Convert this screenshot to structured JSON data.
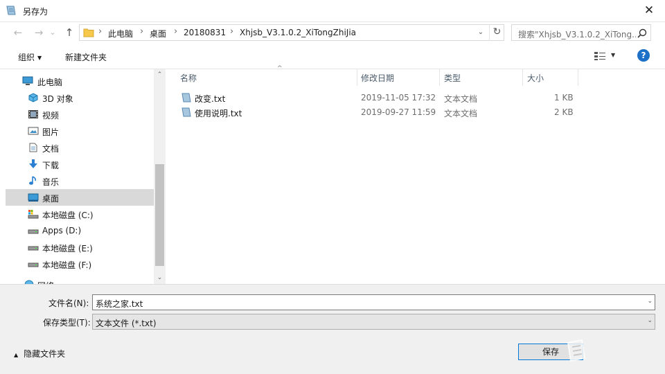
{
  "window": {
    "title": "另存为",
    "close_glyph": "✕"
  },
  "nav": {
    "back_glyph": "←",
    "forward_glyph": "→",
    "recent_glyph": "⌄",
    "up_glyph": "↑",
    "breadcrumb": [
      "此电脑",
      "桌面",
      "20180831",
      "Xhjsb_V3.1.0.2_XiTongZhiJia"
    ],
    "separator": "›",
    "dropdown_glyph": "⌄",
    "refresh_glyph": "↻",
    "search_placeholder": "搜索\"Xhjsb_V3.1.0.2_XiTong..."
  },
  "toolbar": {
    "organize": "组织",
    "caret": "▼",
    "new_folder": "新建文件夹",
    "help": "?"
  },
  "sidebar": {
    "items": [
      {
        "label": "此电脑",
        "icon": "pc-icon"
      },
      {
        "label": "3D 对象",
        "icon": "3d-objects-icon"
      },
      {
        "label": "视频",
        "icon": "video-icon"
      },
      {
        "label": "图片",
        "icon": "pictures-icon"
      },
      {
        "label": "文档",
        "icon": "documents-icon"
      },
      {
        "label": "下载",
        "icon": "download-icon"
      },
      {
        "label": "音乐",
        "icon": "music-icon"
      },
      {
        "label": "桌面",
        "icon": "desktop-icon",
        "selected": true
      },
      {
        "label": "本地磁盘 (C:)",
        "icon": "system-drive-icon"
      },
      {
        "label": "Apps (D:)",
        "icon": "drive-icon"
      },
      {
        "label": "本地磁盘 (E:)",
        "icon": "drive-icon"
      },
      {
        "label": "本地磁盘 (F:)",
        "icon": "drive-icon"
      },
      {
        "label": "网络",
        "icon": "network-icon"
      }
    ],
    "scroll_up_glyph": "⌃",
    "scroll_down_glyph": "⌄"
  },
  "files": {
    "columns": {
      "name": "名称",
      "modified": "修改日期",
      "type": "类型",
      "size": "大小"
    },
    "sort_glyph": "^",
    "rows": [
      {
        "name": "改变.txt",
        "modified": "2019-11-05 17:32",
        "type": "文本文档",
        "size": "1 KB"
      },
      {
        "name": "使用说明.txt",
        "modified": "2019-09-27 11:59",
        "type": "文本文档",
        "size": "2 KB"
      }
    ]
  },
  "form": {
    "filename_label": "文件名(N):",
    "filename_value": "系统之家.txt",
    "filetype_label": "保存类型(T):",
    "filetype_value": "文本文件 (*.txt)",
    "dropdown_glyph": "⌄",
    "hide_folders": "隐藏文件夹",
    "hide_caret": "▲",
    "save_button": "保存"
  },
  "colors": {
    "accent": "#0078d7",
    "selected": "#d9d9d9",
    "folder": "#f6c94c",
    "help": "#1c70c7"
  }
}
